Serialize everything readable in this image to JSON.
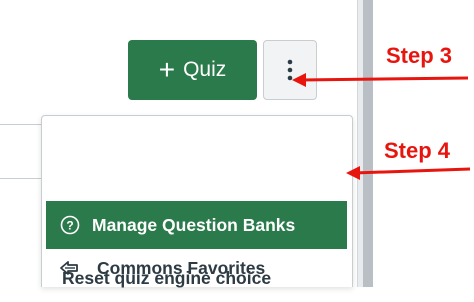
{
  "toolbar": {
    "quiz_button_label": "Quiz",
    "quiz_button_plus": "+"
  },
  "menu": {
    "items": [
      {
        "label": "Manage Question Banks",
        "icon": "question-circle-icon",
        "active": true
      },
      {
        "label": "Reset quiz engine choice",
        "icon": "",
        "active": false
      },
      {
        "label": "Commons Favorites",
        "icon": "commons-share-icon",
        "active": false
      }
    ]
  },
  "annotations": {
    "step3": "Step 3",
    "step4": "Step 4"
  },
  "colors": {
    "primary_green": "#2b7a4b",
    "annotation_red": "#e8150f",
    "text_dark": "#2d3b45"
  }
}
